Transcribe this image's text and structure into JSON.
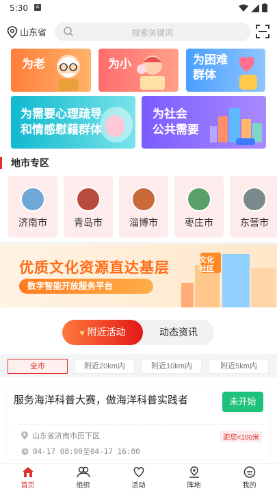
{
  "status_bar": {
    "time": "5:30",
    "notif_badge": "A"
  },
  "header": {
    "location": "山东省",
    "search_placeholder": "搜索关键词"
  },
  "service_cards": [
    {
      "label": "为老"
    },
    {
      "label": "为小"
    },
    {
      "label": "为困难群体",
      "line1": "为困难",
      "line2": "群体"
    },
    {
      "label": "为需要心理疏导和情感慰藉群体",
      "line1": "为需要心理疏导",
      "line2": "和情感慰藉群体"
    },
    {
      "label": "为社会公共需要",
      "line1": "为社会",
      "line2": "公共需要"
    }
  ],
  "cities": {
    "section_title": "地市专区",
    "items": [
      {
        "name": "济南市",
        "color": "#6fa7d8"
      },
      {
        "name": "青岛市",
        "color": "#b84a3e"
      },
      {
        "name": "淄博市",
        "color": "#c96a3a"
      },
      {
        "name": "枣庄市",
        "color": "#5aa06a"
      },
      {
        "name": "东营市",
        "color": "#7a8a8a"
      }
    ]
  },
  "banner": {
    "headline": "优质文化资源直达基层",
    "subline": "数字智能开放服务平台",
    "badge1": "文化",
    "badge2": "社区"
  },
  "activity": {
    "tabs": [
      "附近活动",
      "动态资讯"
    ],
    "filters": [
      "全市",
      "附近20km内",
      "附近10km内",
      "附近5km内"
    ],
    "items": [
      {
        "title": "服务海洋科普大赛，做海洋科普实践者",
        "status": "未开始",
        "address": "山东省济南市历下区",
        "time": "04-17 08:00至04-17 16:00",
        "distance": "距您<100米"
      }
    ]
  },
  "tabbar": [
    "首页",
    "组织",
    "活动",
    "阵地",
    "我的"
  ],
  "colors": {
    "accent": "#e0322e",
    "status_green": "#1ec27a"
  }
}
